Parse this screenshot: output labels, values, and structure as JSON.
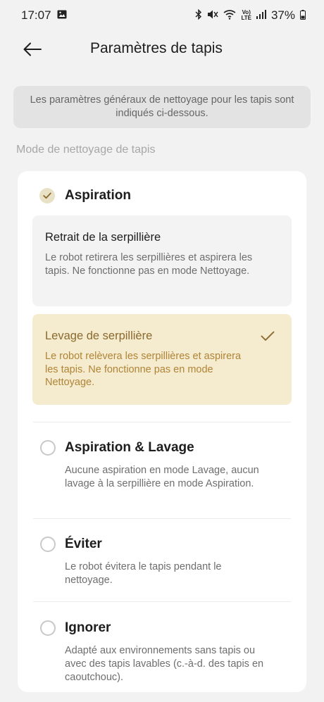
{
  "status_bar": {
    "time": "17:07",
    "battery": "37%",
    "network": "LTE"
  },
  "header": {
    "title": "Paramètres de tapis",
    "back_icon": "arrow-left-icon"
  },
  "info_banner": {
    "text": "Les paramètres généraux de nettoyage pour les tapis sont indiqués ci-dessous."
  },
  "section": {
    "label": "Mode de nettoyage de tapis"
  },
  "options": [
    {
      "title": "Aspiration",
      "selected": true,
      "sub_options": [
        {
          "title": "Retrait de la serpillière",
          "description": "Le robot retirera les serpillières et aspirera les tapis. Ne fonctionne pas en mode Nettoyage.",
          "selected": false
        },
        {
          "title": "Levage de serpillière",
          "description": "Le robot relèvera les serpillières et aspirera les tapis. Ne fonctionne pas en mode Nettoyage.",
          "selected": true
        }
      ]
    },
    {
      "title": "Aspiration & Lavage",
      "description": "Aucune aspiration en mode Lavage, aucun lavage à la serpillière en mode Aspiration.",
      "selected": false
    },
    {
      "title": "Éviter",
      "description": "Le robot évitera le tapis pendant le nettoyage.",
      "selected": false
    },
    {
      "title": "Ignorer",
      "description": "Adapté aux environnements sans tapis ou avec des tapis lavables (c.-à-d. des tapis en caoutchouc).",
      "selected": false
    }
  ],
  "colors": {
    "accent": "#8a6a2e",
    "selected_box": "#f5ebcf",
    "check_fill": "#e9e1c5"
  }
}
